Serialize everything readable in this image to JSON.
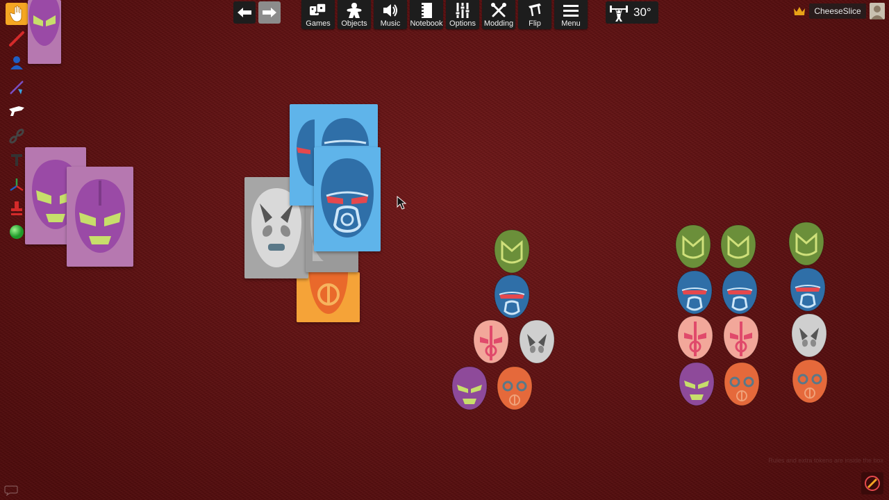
{
  "toolbar": {
    "games_label": "Games",
    "objects_label": "Objects",
    "music_label": "Music",
    "notebook_label": "Notebook",
    "options_label": "Options",
    "modding_label": "Modding",
    "flip_label": "Flip",
    "menu_label": "Menu",
    "rotation_value": "30°"
  },
  "player": {
    "name": "CheeseSlice"
  },
  "footer": {
    "hint_text": "Rules and extra tokens are inside the box"
  },
  "colors": {
    "table_felt": "#6a0f10",
    "mask_green": "#6b8f3a",
    "mask_blue": "#2f6fa8",
    "mask_pink": "#f2a79a",
    "mask_gray": "#cfcfcf",
    "mask_orange": "#e5693b",
    "mask_purple": "#8e4a9a"
  },
  "icons": {
    "left_tools": [
      "grab-hand-icon",
      "pen-icon",
      "player-icon",
      "line-icon",
      "gizmo-icon",
      "joint-icon",
      "text-icon",
      "snap-icon",
      "flag-icon",
      "ball-icon"
    ]
  }
}
